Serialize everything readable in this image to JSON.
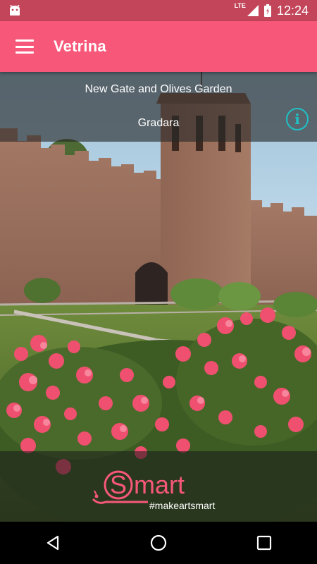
{
  "status_bar": {
    "network_label": "LTE",
    "time": "12:24"
  },
  "app_bar": {
    "title": "Vetrina",
    "menu_icon": "hamburger-menu-icon"
  },
  "poi": {
    "title": "New Gate and Olives Garden",
    "city": "Gradara",
    "info_label": "i"
  },
  "logo": {
    "brand": "Smart",
    "hashtag": "#makeartsmart"
  },
  "nav": {
    "back_icon": "back-icon",
    "home_icon": "home-icon",
    "recents_icon": "recents-icon"
  },
  "colors": {
    "status_bar": "#c2455a",
    "app_bar": "#f7587a",
    "info_accent": "#1fc1c6",
    "logo_pink": "#f7587a"
  }
}
